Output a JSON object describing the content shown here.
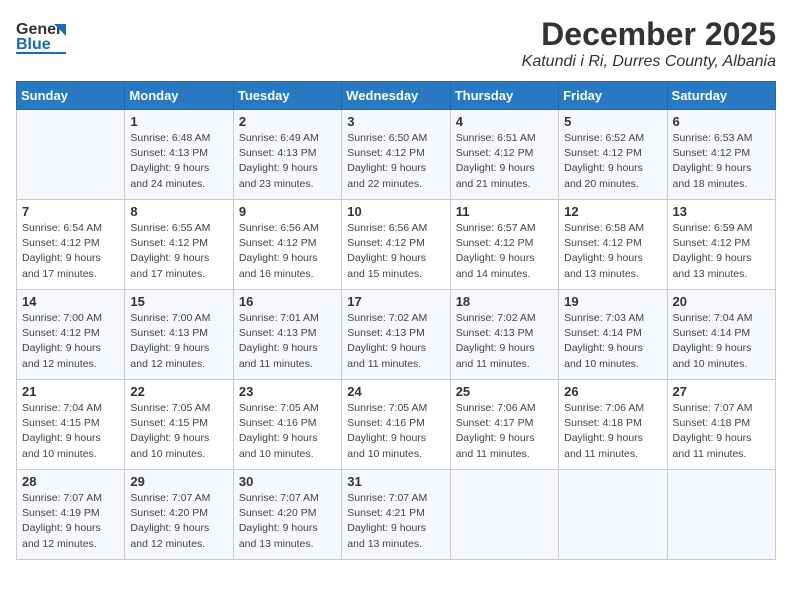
{
  "logo": {
    "general": "General",
    "blue": "Blue"
  },
  "title": {
    "month": "December 2025",
    "location": "Katundi i Ri, Durres County, Albania"
  },
  "calendar": {
    "headers": [
      "Sunday",
      "Monday",
      "Tuesday",
      "Wednesday",
      "Thursday",
      "Friday",
      "Saturday"
    ],
    "weeks": [
      [
        {
          "day": "",
          "sunrise": "",
          "sunset": "",
          "daylight": ""
        },
        {
          "day": "1",
          "sunrise": "Sunrise: 6:48 AM",
          "sunset": "Sunset: 4:13 PM",
          "daylight": "Daylight: 9 hours and 24 minutes."
        },
        {
          "day": "2",
          "sunrise": "Sunrise: 6:49 AM",
          "sunset": "Sunset: 4:13 PM",
          "daylight": "Daylight: 9 hours and 23 minutes."
        },
        {
          "day": "3",
          "sunrise": "Sunrise: 6:50 AM",
          "sunset": "Sunset: 4:12 PM",
          "daylight": "Daylight: 9 hours and 22 minutes."
        },
        {
          "day": "4",
          "sunrise": "Sunrise: 6:51 AM",
          "sunset": "Sunset: 4:12 PM",
          "daylight": "Daylight: 9 hours and 21 minutes."
        },
        {
          "day": "5",
          "sunrise": "Sunrise: 6:52 AM",
          "sunset": "Sunset: 4:12 PM",
          "daylight": "Daylight: 9 hours and 20 minutes."
        },
        {
          "day": "6",
          "sunrise": "Sunrise: 6:53 AM",
          "sunset": "Sunset: 4:12 PM",
          "daylight": "Daylight: 9 hours and 18 minutes."
        }
      ],
      [
        {
          "day": "7",
          "sunrise": "Sunrise: 6:54 AM",
          "sunset": "Sunset: 4:12 PM",
          "daylight": "Daylight: 9 hours and 17 minutes."
        },
        {
          "day": "8",
          "sunrise": "Sunrise: 6:55 AM",
          "sunset": "Sunset: 4:12 PM",
          "daylight": "Daylight: 9 hours and 17 minutes."
        },
        {
          "day": "9",
          "sunrise": "Sunrise: 6:56 AM",
          "sunset": "Sunset: 4:12 PM",
          "daylight": "Daylight: 9 hours and 16 minutes."
        },
        {
          "day": "10",
          "sunrise": "Sunrise: 6:56 AM",
          "sunset": "Sunset: 4:12 PM",
          "daylight": "Daylight: 9 hours and 15 minutes."
        },
        {
          "day": "11",
          "sunrise": "Sunrise: 6:57 AM",
          "sunset": "Sunset: 4:12 PM",
          "daylight": "Daylight: 9 hours and 14 minutes."
        },
        {
          "day": "12",
          "sunrise": "Sunrise: 6:58 AM",
          "sunset": "Sunset: 4:12 PM",
          "daylight": "Daylight: 9 hours and 13 minutes."
        },
        {
          "day": "13",
          "sunrise": "Sunrise: 6:59 AM",
          "sunset": "Sunset: 4:12 PM",
          "daylight": "Daylight: 9 hours and 13 minutes."
        }
      ],
      [
        {
          "day": "14",
          "sunrise": "Sunrise: 7:00 AM",
          "sunset": "Sunset: 4:12 PM",
          "daylight": "Daylight: 9 hours and 12 minutes."
        },
        {
          "day": "15",
          "sunrise": "Sunrise: 7:00 AM",
          "sunset": "Sunset: 4:13 PM",
          "daylight": "Daylight: 9 hours and 12 minutes."
        },
        {
          "day": "16",
          "sunrise": "Sunrise: 7:01 AM",
          "sunset": "Sunset: 4:13 PM",
          "daylight": "Daylight: 9 hours and 11 minutes."
        },
        {
          "day": "17",
          "sunrise": "Sunrise: 7:02 AM",
          "sunset": "Sunset: 4:13 PM",
          "daylight": "Daylight: 9 hours and 11 minutes."
        },
        {
          "day": "18",
          "sunrise": "Sunrise: 7:02 AM",
          "sunset": "Sunset: 4:13 PM",
          "daylight": "Daylight: 9 hours and 11 minutes."
        },
        {
          "day": "19",
          "sunrise": "Sunrise: 7:03 AM",
          "sunset": "Sunset: 4:14 PM",
          "daylight": "Daylight: 9 hours and 10 minutes."
        },
        {
          "day": "20",
          "sunrise": "Sunrise: 7:04 AM",
          "sunset": "Sunset: 4:14 PM",
          "daylight": "Daylight: 9 hours and 10 minutes."
        }
      ],
      [
        {
          "day": "21",
          "sunrise": "Sunrise: 7:04 AM",
          "sunset": "Sunset: 4:15 PM",
          "daylight": "Daylight: 9 hours and 10 minutes."
        },
        {
          "day": "22",
          "sunrise": "Sunrise: 7:05 AM",
          "sunset": "Sunset: 4:15 PM",
          "daylight": "Daylight: 9 hours and 10 minutes."
        },
        {
          "day": "23",
          "sunrise": "Sunrise: 7:05 AM",
          "sunset": "Sunset: 4:16 PM",
          "daylight": "Daylight: 9 hours and 10 minutes."
        },
        {
          "day": "24",
          "sunrise": "Sunrise: 7:05 AM",
          "sunset": "Sunset: 4:16 PM",
          "daylight": "Daylight: 9 hours and 10 minutes."
        },
        {
          "day": "25",
          "sunrise": "Sunrise: 7:06 AM",
          "sunset": "Sunset: 4:17 PM",
          "daylight": "Daylight: 9 hours and 11 minutes."
        },
        {
          "day": "26",
          "sunrise": "Sunrise: 7:06 AM",
          "sunset": "Sunset: 4:18 PM",
          "daylight": "Daylight: 9 hours and 11 minutes."
        },
        {
          "day": "27",
          "sunrise": "Sunrise: 7:07 AM",
          "sunset": "Sunset: 4:18 PM",
          "daylight": "Daylight: 9 hours and 11 minutes."
        }
      ],
      [
        {
          "day": "28",
          "sunrise": "Sunrise: 7:07 AM",
          "sunset": "Sunset: 4:19 PM",
          "daylight": "Daylight: 9 hours and 12 minutes."
        },
        {
          "day": "29",
          "sunrise": "Sunrise: 7:07 AM",
          "sunset": "Sunset: 4:20 PM",
          "daylight": "Daylight: 9 hours and 12 minutes."
        },
        {
          "day": "30",
          "sunrise": "Sunrise: 7:07 AM",
          "sunset": "Sunset: 4:20 PM",
          "daylight": "Daylight: 9 hours and 13 minutes."
        },
        {
          "day": "31",
          "sunrise": "Sunrise: 7:07 AM",
          "sunset": "Sunset: 4:21 PM",
          "daylight": "Daylight: 9 hours and 13 minutes."
        },
        {
          "day": "",
          "sunrise": "",
          "sunset": "",
          "daylight": ""
        },
        {
          "day": "",
          "sunrise": "",
          "sunset": "",
          "daylight": ""
        },
        {
          "day": "",
          "sunrise": "",
          "sunset": "",
          "daylight": ""
        }
      ]
    ]
  }
}
